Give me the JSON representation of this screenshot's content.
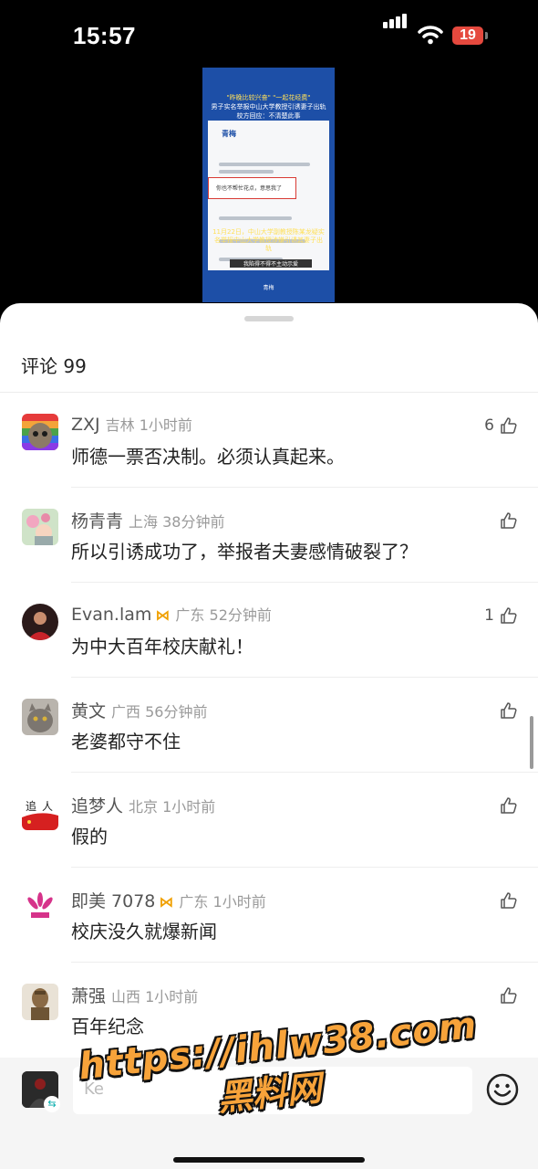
{
  "status_bar": {
    "time": "15:57",
    "battery": "19"
  },
  "video_thumbnail": {
    "headline_1": "\"昨晚比较兴奋\" \"一起花经费\"",
    "headline_2": "男子实名举报中山大学教授引诱妻子出轨",
    "headline_3": "校方回应：不清楚此事",
    "logo": "青梅",
    "highlight_text": "你也不帮忙花点，意思我了",
    "caption": "11月22日，中山大学副教授陈某龙疑实名举报中山大学教授涉嫌引诱其妻子出轨",
    "subtitle": "我陷得不得不主动示爱",
    "footer": "青梅"
  },
  "comments_header": {
    "title": "评论 99"
  },
  "comments": [
    {
      "name": "ZXJ",
      "location": "吉林",
      "time": "1小时前",
      "text": "师德一票否决制。必须认真起来。",
      "likes": "6",
      "badge": ""
    },
    {
      "name": "杨青青",
      "location": "上海",
      "time": "38分钟前",
      "text": "所以引诱成功了，举报者夫妻感情破裂了？",
      "likes": "",
      "badge": ""
    },
    {
      "name": "Evan.lam",
      "location": "广东",
      "time": "52分钟前",
      "text": "为中大百年校庆献礼！",
      "likes": "1",
      "badge": "crown"
    },
    {
      "name": "黄文",
      "location": "广西",
      "time": "56分钟前",
      "text": "老婆都守不住",
      "likes": "",
      "badge": ""
    },
    {
      "name": "追梦人",
      "location": "北京",
      "time": "1小时前",
      "text": "假的",
      "likes": "",
      "badge": ""
    },
    {
      "name": "即美 7078",
      "location": "广东",
      "time": "1小时前",
      "text": "校庆没久就爆新闻",
      "likes": "",
      "badge": "crown"
    },
    {
      "name": "萧强",
      "location": "山西",
      "time": "1小时前",
      "text": "百年纪念",
      "likes": "",
      "badge": ""
    }
  ],
  "composer": {
    "placeholder": "Ke"
  },
  "watermark": {
    "line1": "https://ihlw38.com",
    "line2": "黑料网"
  },
  "colors": {
    "accent_crown": "#f0a000",
    "battery": "#e5493e"
  }
}
